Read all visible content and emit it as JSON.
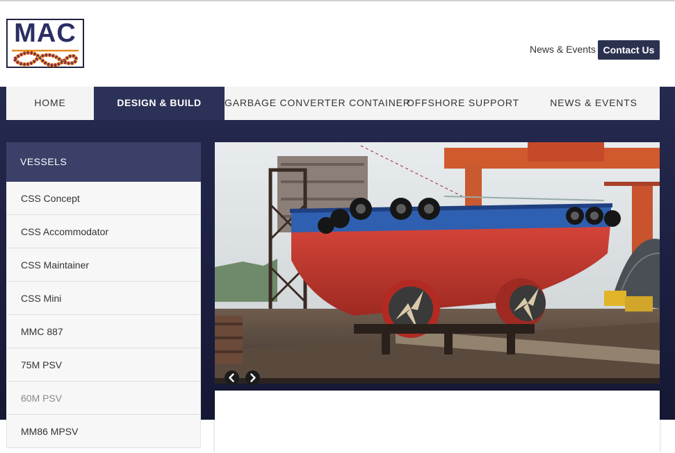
{
  "logo": {
    "text": "MAC"
  },
  "header": {
    "news_link": "News & Events",
    "contact_label": "Contact Us"
  },
  "nav": {
    "items": [
      {
        "label": "HOME"
      },
      {
        "label": "DESIGN & BUILD",
        "active": true
      },
      {
        "label": "GARBAGE CONVERTER CONTAINER"
      },
      {
        "label": "OFFSHORE SUPPORT"
      },
      {
        "label": "NEWS & EVENTS"
      }
    ]
  },
  "sidebar": {
    "title": "VESSELS",
    "items": [
      {
        "label": "CSS Concept"
      },
      {
        "label": "CSS Accommodator"
      },
      {
        "label": "CSS Maintainer"
      },
      {
        "label": "CSS Mini"
      },
      {
        "label": "MMC 887"
      },
      {
        "label": "75M PSV"
      },
      {
        "label": "60M PSV",
        "muted": true
      },
      {
        "label": "MM86 MPSV"
      }
    ]
  },
  "slider": {
    "image": "ship-in-dry-dock-photo",
    "prev_icon": "chevron-left-icon",
    "next_icon": "chevron-right-icon"
  },
  "colors": {
    "brand_dark": "#2c3257",
    "band": "#1c1f40",
    "sidebar_header": "#3a4068",
    "hull_red": "#c8362c",
    "hull_blue": "#2f5fb0"
  }
}
